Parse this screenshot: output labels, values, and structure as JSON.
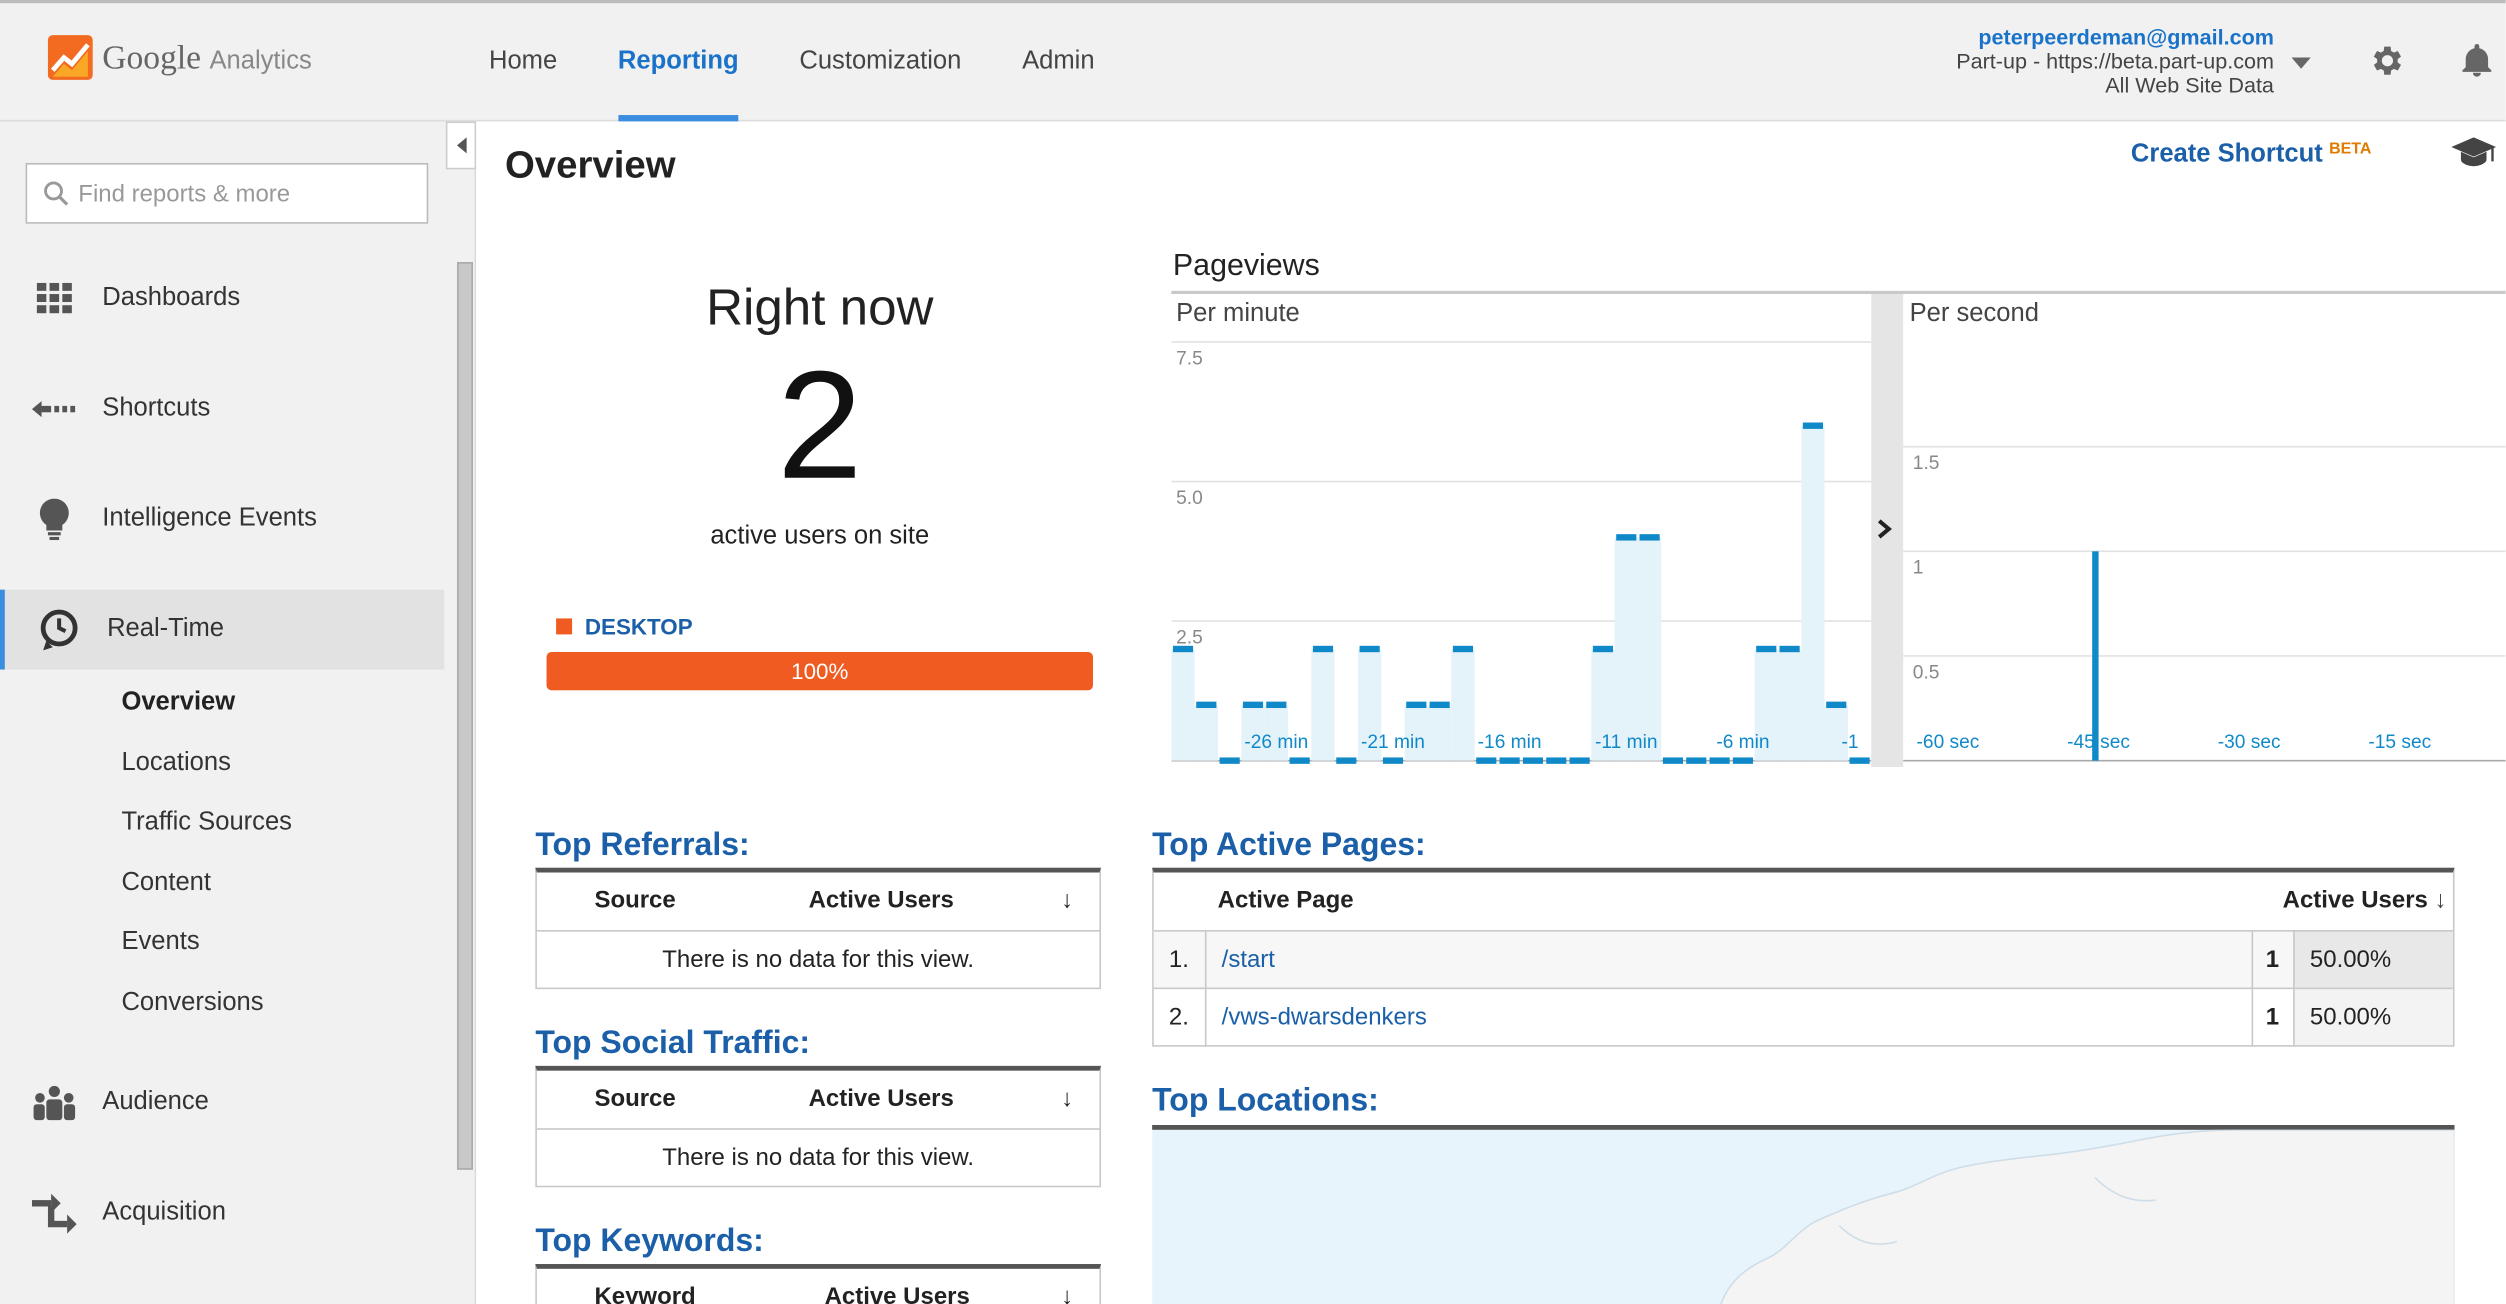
{
  "header": {
    "logo_brand": "Google",
    "logo_product": "Analytics",
    "nav": [
      "Home",
      "Reporting",
      "Customization",
      "Admin"
    ],
    "active_nav": "Reporting",
    "account_email": "peterpeerdeman@gmail.com",
    "account_property": "Part-up - https://beta.part-up.com",
    "account_view": "All Web Site Data"
  },
  "sidebar": {
    "search_placeholder": "Find reports & more",
    "items": [
      {
        "label": "Dashboards",
        "icon": "dashboard-grid-icon"
      },
      {
        "label": "Shortcuts",
        "icon": "shortcut-arrow-icon"
      },
      {
        "label": "Intelligence Events",
        "icon": "lightbulb-icon"
      },
      {
        "label": "Real-Time",
        "icon": "clock-icon"
      },
      {
        "label": "Audience",
        "icon": "people-icon"
      },
      {
        "label": "Acquisition",
        "icon": "acquisition-arrows-icon"
      }
    ],
    "realtime_sub": [
      "Overview",
      "Locations",
      "Traffic Sources",
      "Content",
      "Events",
      "Conversions"
    ],
    "active_sub": "Overview"
  },
  "main": {
    "title": "Overview",
    "shortcut_label": "Create Shortcut",
    "shortcut_badge": "BETA",
    "right_now_title": "Right now",
    "active_users": "2",
    "active_users_label": "active users on site",
    "device_label": "DESKTOP",
    "device_percent": "100%",
    "device_share": 1.0,
    "pageviews_title": "Pageviews",
    "per_minute_label": "Per minute",
    "per_second_label": "Per second"
  },
  "chart_data": [
    {
      "type": "bar",
      "title": "Per minute",
      "y_ticks": [
        "2.5",
        "5.0",
        "7.5"
      ],
      "ylim": [
        0,
        7.5
      ],
      "x_tick_labels": [
        "-26 min",
        "-21 min",
        "-16 min",
        "-11 min",
        "-6 min",
        "-1"
      ],
      "categories": [
        -30,
        -29,
        -28,
        -27,
        -26,
        -25,
        -24,
        -23,
        -22,
        -21,
        -20,
        -19,
        -18,
        -17,
        -16,
        -15,
        -14,
        -13,
        -12,
        -11,
        -10,
        -9,
        -8,
        -7,
        -6,
        -5,
        -4,
        -3,
        -2,
        -1
      ],
      "values": [
        2,
        1,
        0,
        1,
        1,
        0,
        2,
        0,
        2,
        0,
        1,
        1,
        2,
        0,
        0,
        0,
        0,
        0,
        2,
        4,
        4,
        0,
        0,
        0,
        0,
        2,
        2,
        6,
        1,
        0
      ]
    },
    {
      "type": "bar",
      "title": "Per second",
      "y_ticks": [
        "0.5",
        "1",
        "1.5"
      ],
      "ylim": [
        0,
        2
      ],
      "x_tick_labels": [
        "-60 sec",
        "-45 sec",
        "-30 sec",
        "-15 sec"
      ],
      "x_range": [
        -60,
        0
      ],
      "spikes": [
        {
          "x": -45,
          "value": 1
        }
      ]
    }
  ],
  "top_referrals": {
    "title": "Top Referrals:",
    "columns": [
      "Source",
      "Active Users"
    ],
    "empty_text": "There is no data for this view."
  },
  "top_social": {
    "title": "Top Social Traffic:",
    "columns": [
      "Source",
      "Active Users"
    ],
    "empty_text": "There is no data for this view."
  },
  "top_keywords": {
    "title": "Top Keywords:",
    "columns": [
      "Keyword",
      "Active Users"
    ]
  },
  "top_pages": {
    "title": "Top Active Pages:",
    "columns": [
      "Active Page",
      "Active Users"
    ],
    "rows": [
      {
        "rank": "1.",
        "page": "/start",
        "users": "1",
        "pct": "50.00%"
      },
      {
        "rank": "2.",
        "page": "/vws-dwarsdenkers",
        "users": "1",
        "pct": "50.00%"
      }
    ]
  },
  "top_locations": {
    "title": "Top Locations:"
  },
  "colors": {
    "accent_blue": "#1a5fa8",
    "device_orange": "#f05b22",
    "chart_blue": "#1089c9"
  }
}
